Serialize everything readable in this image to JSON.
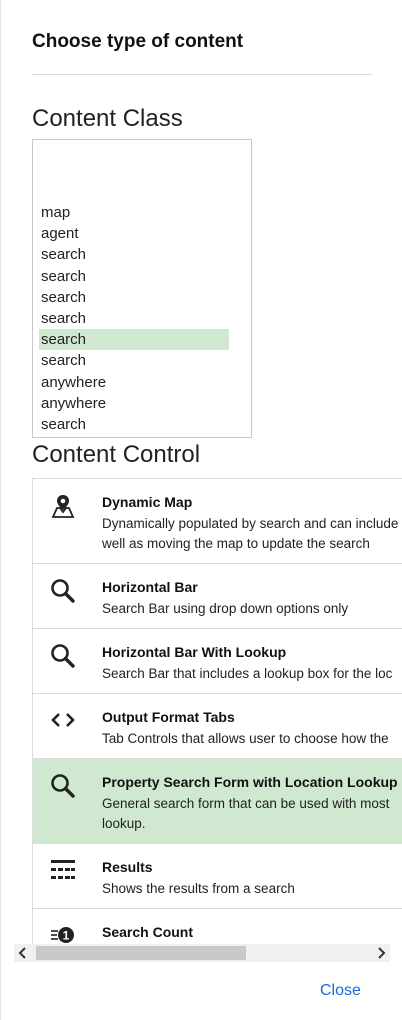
{
  "dialog": {
    "title": "Choose type of content",
    "close_label": "Close"
  },
  "content_class": {
    "heading": "Content Class",
    "items": [
      {
        "label": "map",
        "selected": false
      },
      {
        "label": "agent",
        "selected": false
      },
      {
        "label": "search",
        "selected": false
      },
      {
        "label": "search",
        "selected": false
      },
      {
        "label": "search",
        "selected": false
      },
      {
        "label": "search",
        "selected": false
      },
      {
        "label": "search",
        "selected": true
      },
      {
        "label": "search",
        "selected": false
      },
      {
        "label": "anywhere",
        "selected": false
      },
      {
        "label": "anywhere",
        "selected": false
      },
      {
        "label": "search",
        "selected": false
      }
    ]
  },
  "content_control": {
    "heading": "Content Control",
    "items": [
      {
        "name": "Dynamic Map",
        "desc1": "Dynamically populated by search and can include",
        "desc2": "well as moving the map to update the search",
        "icon": "map-pin-icon",
        "selected": false
      },
      {
        "name": "Horizontal Bar",
        "desc1": "Search Bar using drop down options only",
        "desc2": "",
        "icon": "search-icon",
        "selected": false
      },
      {
        "name": "Horizontal Bar With Lookup",
        "desc1": "Search Bar that includes a lookup box for the loc",
        "desc2": "",
        "icon": "search-icon",
        "selected": false
      },
      {
        "name": "Output Format Tabs",
        "desc1": "Tab Controls that allows user to choose how the",
        "desc2": "",
        "icon": "code-brackets-icon",
        "selected": false
      },
      {
        "name": "Property Search Form with Location Lookup",
        "desc1": "General search form that can be used with most",
        "desc2": "lookup.",
        "icon": "search-icon",
        "selected": true
      },
      {
        "name": "Results",
        "desc1": "Shows the results from a search",
        "desc2": "",
        "icon": "results-list-icon",
        "selected": false
      },
      {
        "name": "Search Count",
        "desc1": "",
        "desc2": "",
        "icon": "counter-icon",
        "selected": false
      }
    ]
  },
  "colors": {
    "selected_bg": "#cfe8cf",
    "link": "#1a6bd6"
  }
}
